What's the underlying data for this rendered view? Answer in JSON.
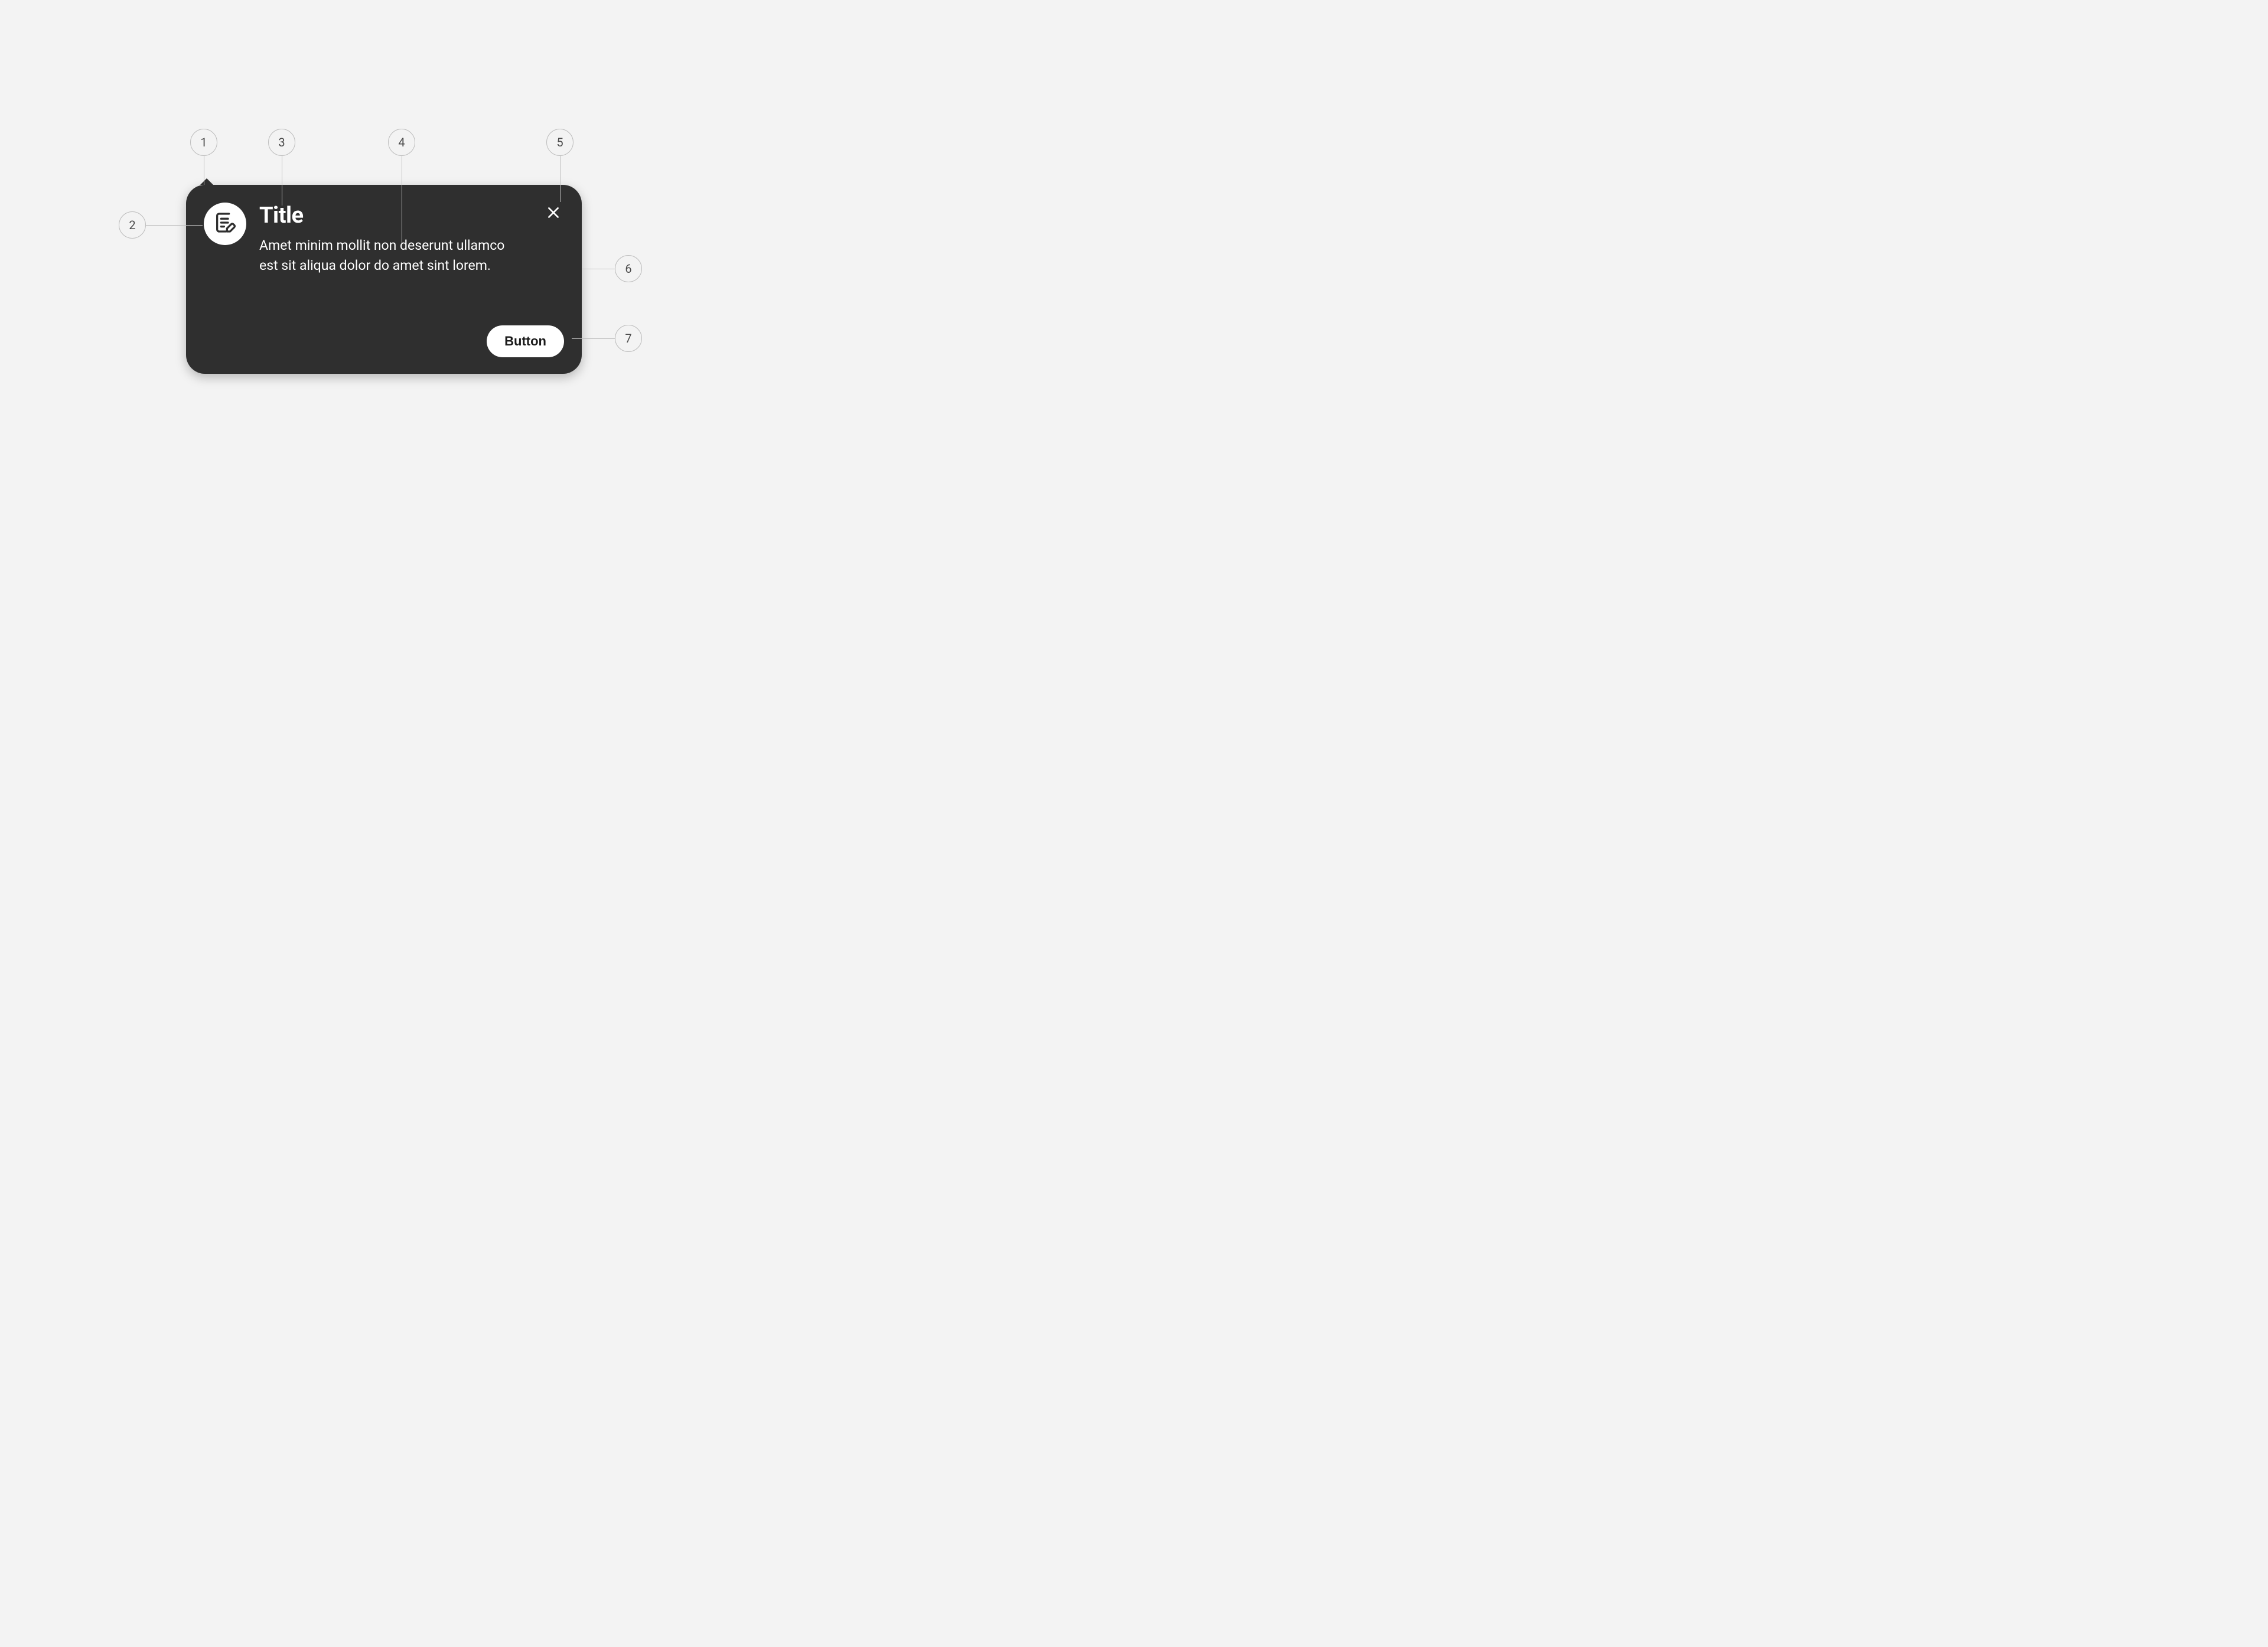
{
  "popover": {
    "title": "Title",
    "description": "Amet minim mollit non deserunt ullamco est sit aliqua dolor do amet sint lorem.",
    "action_label": "Button",
    "icon": "edit-note-icon",
    "close_icon": "close-icon",
    "arrow_icon": "arrow-tip"
  },
  "annotations": {
    "m1": "1",
    "m2": "2",
    "m3": "3",
    "m4": "4",
    "m5": "5",
    "m6": "6",
    "m7": "7"
  }
}
